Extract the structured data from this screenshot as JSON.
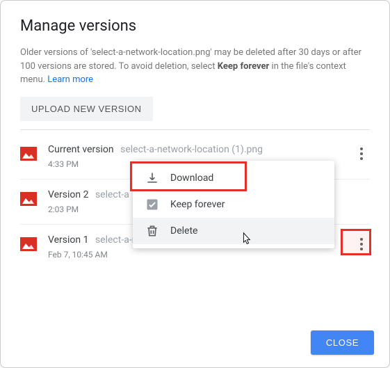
{
  "dialog": {
    "title": "Manage versions",
    "description_pre": "Older versions of 'select-a-network-location.png' may be deleted after 30 days or after 100 versions are stored. To avoid deletion, select ",
    "description_bold": "Keep forever",
    "description_post": " in the file's context menu. ",
    "learn_more": "Learn more"
  },
  "upload_button": "UPLOAD NEW VERSION",
  "versions": [
    {
      "label": "Current version",
      "filename": "select-a-network-location (1).png",
      "time": "4:33 PM"
    },
    {
      "label": "Version 2",
      "filename": "select-a",
      "time": "2:03 PM"
    },
    {
      "label": "Version 1",
      "filename": "select-a-network-location.png",
      "time": "Feb 7, 10:45 AM"
    }
  ],
  "menu": {
    "download": "Download",
    "keep_forever": "Keep forever",
    "delete": "Delete"
  },
  "footer": {
    "close": "CLOSE"
  }
}
